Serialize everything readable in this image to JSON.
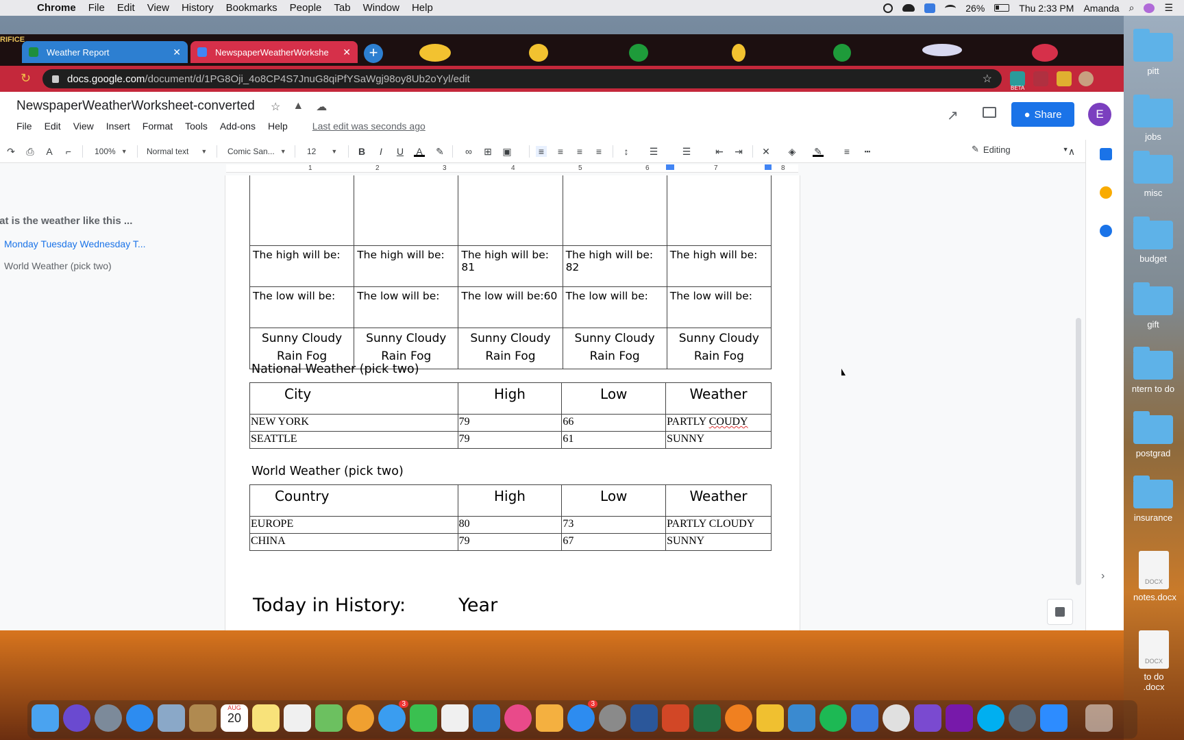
{
  "menubar": {
    "items": [
      "Chrome",
      "File",
      "Edit",
      "View",
      "History",
      "Bookmarks",
      "People",
      "Tab",
      "Window",
      "Help"
    ],
    "battery": "26%",
    "clock": "Thu 2:33 PM",
    "user": "Amanda"
  },
  "browser": {
    "tabs": [
      {
        "title": "Weather Report",
        "favicon": "classroom-icon"
      },
      {
        "title": "NewspaperWeatherWorkshe",
        "favicon": "docs-icon"
      }
    ],
    "url_host": "docs.google.com",
    "url_path": "/document/d/1PG8Oji_4o8CP4S7JnuG8qiPfYSaWgj98oy8Ub2oYyl/edit",
    "ext_badge": "BETA",
    "tab_corner_text": "RIFICE"
  },
  "docs": {
    "title": "NewspaperWeatherWorksheet-converted",
    "menu": [
      "File",
      "Edit",
      "View",
      "Insert",
      "Format",
      "Tools",
      "Add-ons",
      "Help"
    ],
    "last_edit": "Last edit was seconds ago",
    "share_label": "Share",
    "avatar_letter": "E",
    "toolbar": {
      "zoom": "100%",
      "style": "Normal text",
      "font": "Comic San...",
      "size": "12",
      "mode": "Editing"
    },
    "ruler_numbers": [
      "1",
      "2",
      "3",
      "4",
      "5",
      "6",
      "7",
      "8"
    ]
  },
  "outline": {
    "heading": "hat is the weather like this ...",
    "items": [
      "Monday Tuesday Wednesday T...",
      "World Weather (pick two)"
    ]
  },
  "forecast": {
    "high": [
      "The high will be:",
      "The high will be:",
      "The high will be: 81",
      "The high will be: 82",
      "The high will be:"
    ],
    "low": [
      "The low will be:",
      "The low will be:",
      "The low will be:60",
      "The low will be:",
      "The low will be:"
    ],
    "conditions_line1": "Sunny Cloudy",
    "conditions_line2": "Rain Fog"
  },
  "national": {
    "title": "National Weather (pick two)",
    "headers": [
      "City",
      "High",
      "Low",
      "Weather"
    ],
    "rows": [
      [
        "NEW YORK",
        "79",
        "66",
        "PARTLY ",
        "COUDY"
      ],
      [
        "SEATTLE",
        "79",
        "61",
        "SUNNY",
        ""
      ]
    ]
  },
  "world": {
    "title": "World Weather (pick two)",
    "headers": [
      "Country",
      "High",
      "Low",
      "Weather"
    ],
    "rows": [
      [
        "EUROPE",
        "80",
        "73",
        "PARTLY CLOUDY"
      ],
      [
        "CHINA",
        "79",
        "67",
        "SUNNY"
      ]
    ]
  },
  "history": {
    "label": "Today in History:",
    "year": "Year"
  },
  "desktop": {
    "folders": [
      "pitt",
      "jobs",
      "misc",
      "budget",
      "gift",
      "ntern to do",
      "postgrad",
      "insurance"
    ],
    "files": [
      {
        "label": "notes.docx",
        "ext": "DOCX"
      },
      {
        "label": "to do .docx",
        "ext": "DOCX"
      }
    ],
    "calendar_badge": "AUG",
    "calendar_day": "20",
    "badge_messages": "3",
    "badge_appstore": "3"
  }
}
